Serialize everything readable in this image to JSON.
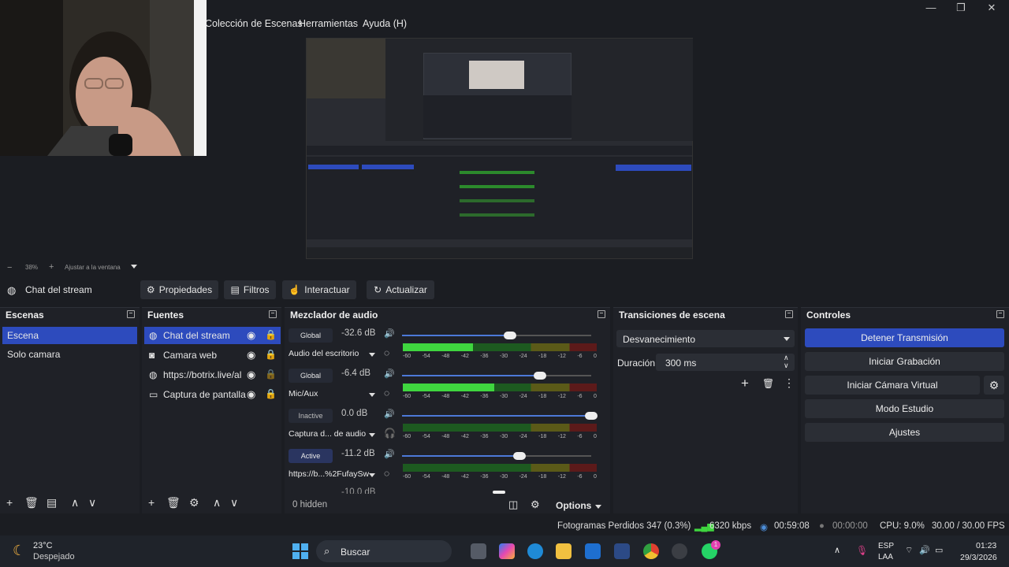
{
  "menu": {
    "items": [
      "Colección de Escenas",
      "Herramientas",
      "Ayuda (H)"
    ]
  },
  "preview_zoom": {
    "minus": "−",
    "percent": "38%",
    "plus": "+",
    "fit_label": "Ajustar a la ventana"
  },
  "source_toolbar": {
    "source_name": "Chat del stream",
    "buttons": [
      "Propiedades",
      "Filtros",
      "Interactuar",
      "Actualizar"
    ]
  },
  "scenes": {
    "title": "Escena",
    "items": [
      "Escena",
      "Solo camara"
    ],
    "selected": 0,
    "header": "Escenas"
  },
  "sources": {
    "header": "Fuentes",
    "items": [
      {
        "name": "Chat del stream",
        "icon": "globe-icon"
      },
      {
        "name": "Camara web",
        "icon": "camera-icon"
      },
      {
        "name": "https://botrix.live/al",
        "icon": "globe-icon"
      },
      {
        "name": "Captura de pantalla",
        "icon": "monitor-icon"
      }
    ]
  },
  "mixer": {
    "header": "Mezclador de audio",
    "channels": [
      {
        "tag": "Global",
        "db": "-32.6 dB",
        "name": "Audio del escritorio",
        "level": 0.36,
        "volume": 0.57
      },
      {
        "tag": "Global",
        "db": "-6.4 dB",
        "name": "Mic/Aux",
        "level": 0.47,
        "volume": 0.73
      },
      {
        "tag": "Inactive",
        "db": "0.0 dB",
        "name": "Captura d... de audio",
        "level": 0.0,
        "volume": 1.0
      },
      {
        "tag": "Active",
        "db": "-11.2 dB",
        "name": "https://b...%2FufaySw",
        "level": 0.0,
        "volume": 0.62
      }
    ],
    "partial_db": "-10.0 dB",
    "ticks": [
      "-60",
      "-54",
      "-48",
      "-42",
      "-36",
      "-30",
      "-24",
      "-18",
      "-12",
      "-6",
      "0"
    ],
    "hidden": "0 hidden",
    "options": "Options"
  },
  "transitions": {
    "header": "Transiciones de escena",
    "selected": "Desvanecimiento",
    "duration_label": "Duración",
    "duration_value": "300 ms"
  },
  "controls": {
    "header": "Controles",
    "buttons": [
      "Detener Transmisión",
      "Iniciar Grabación",
      "Iniciar Cámara Virtual",
      "Modo Estudio",
      "Ajustes"
    ],
    "active_color": "#2d4bbd"
  },
  "status": {
    "dropped": "Fotogramas Perdidos 347 (0.3%)",
    "bitrate": "6320 kbps",
    "stream_time": "00:59:08",
    "rec_time": "00:00:00",
    "cpu": "CPU: 9.0%",
    "fps": "30.00 / 30.00 FPS"
  },
  "taskbar": {
    "weather_temp": "23°C",
    "weather_desc": "Despejado",
    "search_placeholder": "Buscar",
    "lang_top": "ESP",
    "lang_bottom": "LAA",
    "time": "01:23",
    "date": "29/3/2026",
    "whatsapp_badge": "1"
  },
  "preview_inner": {
    "dock_labels": [
      "Escenas",
      "Fuentes",
      "Mezclador de audio",
      "Transiciones de escena",
      "Controles"
    ],
    "search": "Buscar"
  }
}
